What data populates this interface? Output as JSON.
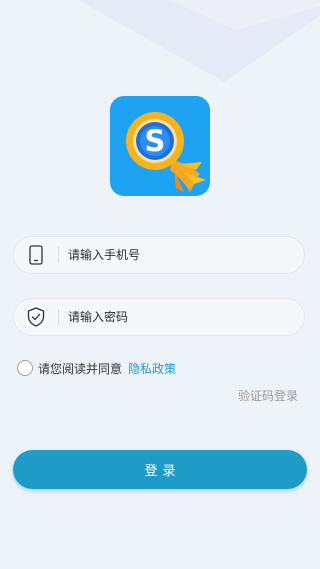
{
  "logo": {
    "letter": "S",
    "accent_color": "#1ea3f2"
  },
  "phone_field": {
    "icon": "phone-icon",
    "placeholder": "请输入手机号",
    "value": ""
  },
  "password_field": {
    "icon": "shield-check-icon",
    "placeholder": "请输入密码",
    "value": ""
  },
  "agreement": {
    "checked": false,
    "text": "请您阅读并同意",
    "link_label": "隐私政策",
    "link_color": "#1e9ccd"
  },
  "code_login_label": "验证码登录",
  "login_button": {
    "label": "登录",
    "color": "#1f9bc7"
  }
}
